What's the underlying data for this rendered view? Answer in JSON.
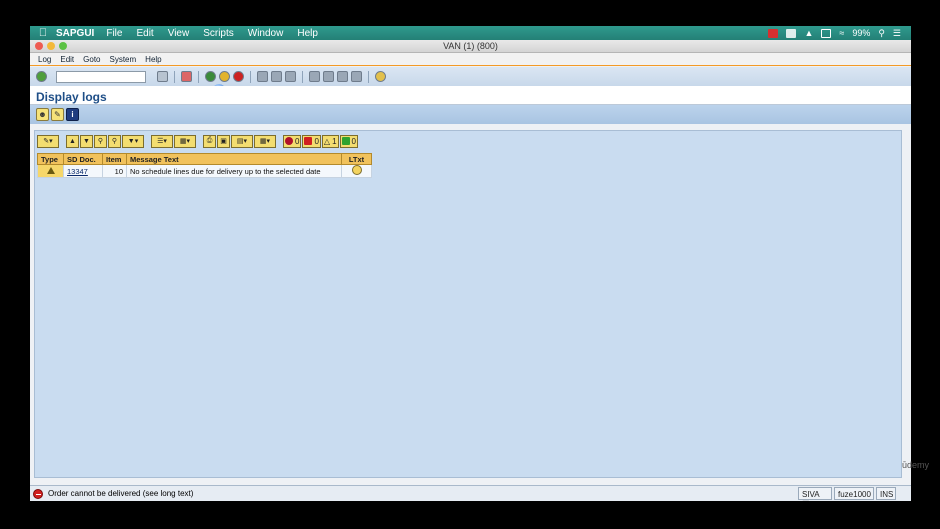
{
  "macmenu": {
    "app": "SAPGUI",
    "items": [
      "File",
      "Edit",
      "View",
      "Scripts",
      "Window",
      "Help"
    ],
    "battery": "99%"
  },
  "window": {
    "title": "VAN (1) (800)"
  },
  "sapmenu": [
    "Log",
    "Edit",
    "Goto",
    "System",
    "Help"
  ],
  "toolbar": {
    "command_value": "",
    "command_placeholder": ""
  },
  "page": {
    "title": "Display logs"
  },
  "counts": {
    "stop": "0",
    "error": "0",
    "warning": "1",
    "success": "0"
  },
  "table": {
    "headers": [
      "Type",
      "SD Doc.",
      "Item",
      "Message Text",
      "LTxt"
    ],
    "rows": [
      {
        "type": "warning",
        "sd_doc": "13347",
        "item": "10",
        "message": "No schedule lines due for delivery up to the selected date"
      }
    ]
  },
  "status": {
    "message": "Order cannot be delivered (see long text)",
    "user": "SIVA",
    "server": "fuze1000",
    "mode": "INS"
  },
  "watermark": "ūdemy",
  "colors": {
    "accent": "#f39a26",
    "header_bg": "#f1c25c",
    "content_bg": "#c9dcf0"
  }
}
